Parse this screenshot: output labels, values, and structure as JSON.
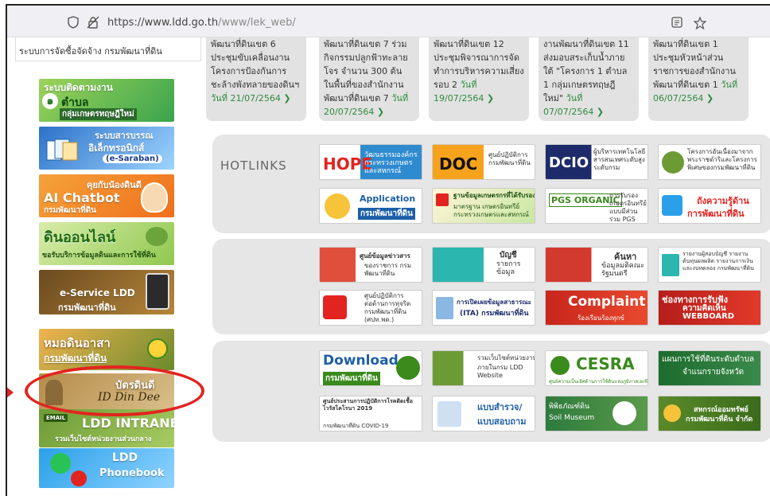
{
  "browser": {
    "url_host": "https://www.ldd.go.th",
    "url_path": "/www/lek_web/"
  },
  "sidebar": {
    "procurement_text": "ระบบการจัดซื้อจัดจ้าง กรมพัฒนาที่ดิน",
    "banners": [
      {
        "line1": "ระบบติดตามงาน",
        "line2": "ตำบล",
        "line3": "กลุ่มเกษตรทฤษฎีใหม่"
      },
      {
        "line1": "ระบบสารบรรณ",
        "line2": "อิเล็กทรอนิกส์",
        "line3": "(e-Saraban)"
      },
      {
        "line1": "คุยกับน้องดินดี",
        "line2": "AI Chatbot",
        "line3": "กรมพัฒนาที่ดิน"
      },
      {
        "line1": "ดินออนไลน์",
        "line2": "ขอรับบริการข้อมูลดินและการใช้ที่ดิน"
      },
      {
        "line1": "e-Service LDD",
        "line2": "กรมพัฒนาที่ดิน"
      },
      {
        "line1": "หมอดินอาสา",
        "line2": "กรมพัฒนาที่ดิน"
      },
      {
        "line1": "บัตรดินดี",
        "line2": "ID Din Dee"
      },
      {
        "line1": "EMAIL",
        "line2": "LDD INTRANET",
        "line3": "รวมเว็บไซต์หน่วยงานส่วนกลาง"
      },
      {
        "line1": "LDD",
        "line2": "Phonebook"
      }
    ]
  },
  "news": [
    {
      "text": "พัฒนาที่ดินเขต 6 ประชุมขับเคลื่อนงานโครงการป้องกันการชะล้างพังทลายของดินฯ",
      "date": "วันที่ 21/07/2564"
    },
    {
      "text": "พัฒนาที่ดินเขต 7 ร่วมกิจกรรมปลูกฟ้าทะลายโจร จำนวน 300 ต้น ในพื้นที่ของสำนักงานพัฒนาที่ดินเขต 7",
      "date": "วันที่ 20/07/2564"
    },
    {
      "text": "พัฒนาที่ดินเขต 12 ประชุมพิจารณาการจัดทำการบริหารความเสี่ยง รอบ 2",
      "date": "วันที่ 19/07/2564"
    },
    {
      "text": "งานพัฒนาที่ดินเขต 11 ส่งมอบสระเก็บน้ำภายใต้ \"โครงการ 1 ตำบล 1 กลุ่มเกษตรทฤษฎีใหม่\"",
      "date": "วันที่ 07/07/2564"
    },
    {
      "text": "พัฒนาที่ดินเขต 1 ประชุมหัวหน้าส่วนราชการของสำนักงานพัฒนาที่ดินเขต 1",
      "date": "วันที่ 06/07/2564"
    }
  ],
  "hotlinks": {
    "title": "HOTLINKS",
    "row1": [
      {
        "big": "HOPE",
        "small": "วัฒนธรรมองค์กร กระทรวงเกษตร และสหกรณ์"
      },
      {
        "big": "DOC",
        "small": "ศูนย์ปฏิบัติการ กรมพัฒนาที่ดิน"
      },
      {
        "big": "DCIO",
        "small": "ผู้บริหารเทคโนโลยีสารสนเทศระดับสูง ระดับกรม"
      },
      {
        "big": "",
        "small": "โครงการอันเนื่องมาจากพระราชดำริและโครงการพิเศษของกรมพัฒนาที่ดิน"
      }
    ],
    "row2": [
      {
        "big": "Application",
        "small": "กรมพัฒนาที่ดิน"
      },
      {
        "big": "ฐานข้อมูลเกษตรกรที่ได้รับรอง",
        "small": "มาตรฐาน เกษตรอินทรีย์ กระทรวงเกษตรและสหกรณ์"
      },
      {
        "big": "PGS ORGANIC",
        "small": "การรับรองเกษตรอินทรีย์แบบมีส่วนร่วม PGS"
      },
      {
        "big": "ถังความรู้ด้าน",
        "small": "การพัฒนาที่ดิน"
      }
    ],
    "row3": [
      {
        "big": "ศูนย์ข้อมูลข่าวสาร",
        "small": "ของราชการ กรมพัฒนาที่ดิน"
      },
      {
        "big": "บัญชี",
        "small": "รายการข้อมูล"
      },
      {
        "big": "ค้นหา",
        "small": "ข้อมูลมติคณะรัฐมนตรี"
      },
      {
        "big": "",
        "small": "รายงานผู้สอบบัญชี รายงานต้นทุนผลผลิต รายงานการเงินและงบทดลอง กรมพัฒนาที่ดิน"
      }
    ],
    "row4": [
      {
        "big": "ศูนย์ปฏิบัติการ",
        "small": "ต่อต้านการทุจริต กรมพัฒนาที่ดิน (ศปท.พด.)"
      },
      {
        "big": "การเปิดเผยข้อมูลสาธารณะ",
        "small": "(ITA) กรมพัฒนาที่ดิน"
      },
      {
        "big": "Complaint",
        "small": "ร้องเรียนร้องทุกข์"
      },
      {
        "big": "ช่องทางการรับฟัง",
        "small": "ความคิดเห็น WEBBOARD"
      }
    ],
    "row5": [
      {
        "big": "Download",
        "small": "กรมพัฒนาที่ดิน"
      },
      {
        "big": "รวมเว็บไซต์หน่วยงาน",
        "small": "ภายในกรม LDD Website"
      },
      {
        "big": "CESRA",
        "small": "ศูนย์ความเป็นเลิศด้านการใช้ดินแห่งภูมิภาคเอเชีย"
      },
      {
        "big": "แผนการใช้ที่ดินระดับตำบล",
        "small": "จำแนกรายจังหวัด"
      }
    ],
    "row6": [
      {
        "big": "ศูนย์ประสานการปฏิบัติการโรคติดเชื้อไวรัสโคโรนา 2019",
        "small": "กรมพัฒนาที่ดิน COVID-19"
      },
      {
        "big": "แบบสำรวจ/",
        "small": "แบบสอบถาม"
      },
      {
        "big": "พิพิธภัณฑ์ดิน",
        "small": "Soil Museum"
      },
      {
        "big": "สหกรณ์ออมทรัพย์",
        "small": "กรมพัฒนาที่ดิน จำกัด"
      }
    ]
  },
  "colors": {
    "highlight": "#e3231f",
    "panel": "#e6e6e6",
    "news_date": "#2e8b3d"
  }
}
